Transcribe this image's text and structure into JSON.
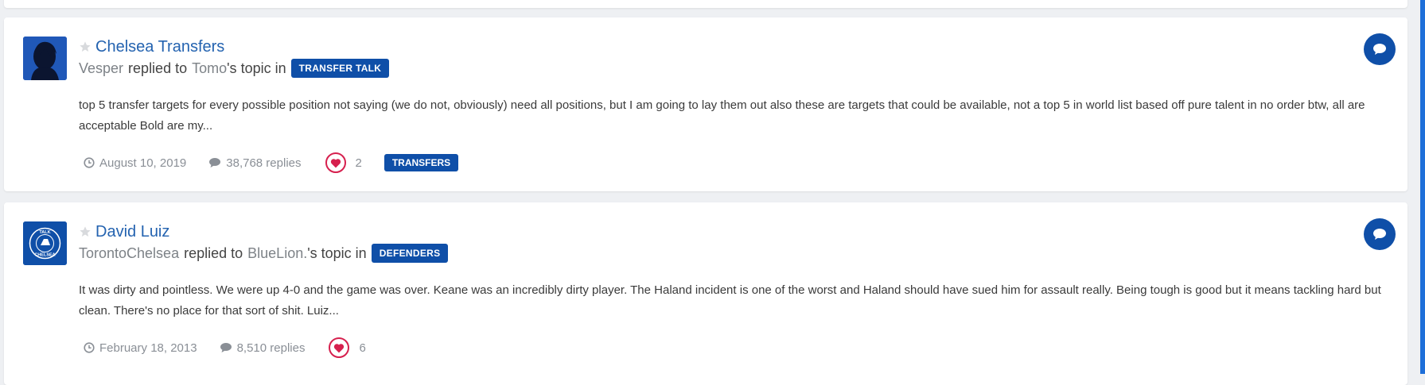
{
  "colors": {
    "accent": "#0f4fa8",
    "link": "#2463b0",
    "heart": "#d6204e",
    "muted": "#8a8f96"
  },
  "activity": [
    {
      "title": "Chelsea Transfers",
      "replier": "Vesper",
      "replied_text": "replied to",
      "topic_owner": "Tomo",
      "topic_suffix": "'s topic in",
      "forum": "TRANSFER TALK",
      "snippet": "top 5 transfer targets for every possible position not saying (we do not, obviously) need all positions, but I am going to lay them out also these are targets that could be available, not a top 5 in world list based off pure talent in no order btw, all are acceptable Bold are my...",
      "date": "August 10, 2019",
      "replies": "38,768 replies",
      "likes": "2",
      "tag": "TRANSFERS",
      "avatar_icon": "silhouette-avatar-icon"
    },
    {
      "title": "David Luiz",
      "replier": "TorontoChelsea",
      "replied_text": "replied to",
      "topic_owner": "BlueLion.",
      "topic_suffix": "'s topic in",
      "forum": "DEFENDERS",
      "snippet": "It was dirty and pointless. We were up 4-0 and the game was over. Keane was an incredibly dirty player. The Haland incident is one of the worst and Haland should have sued him for assault really. Being tough is good but it means tackling hard but clean. There's no place for that sort of shit. Luiz...",
      "date": "February 18, 2013",
      "replies": "8,510 replies",
      "likes": "6",
      "avatar_icon": "talk-chelsea-logo-icon",
      "avatar_text_top": "TALK",
      "avatar_text_bottom": "CHELSEA"
    }
  ]
}
